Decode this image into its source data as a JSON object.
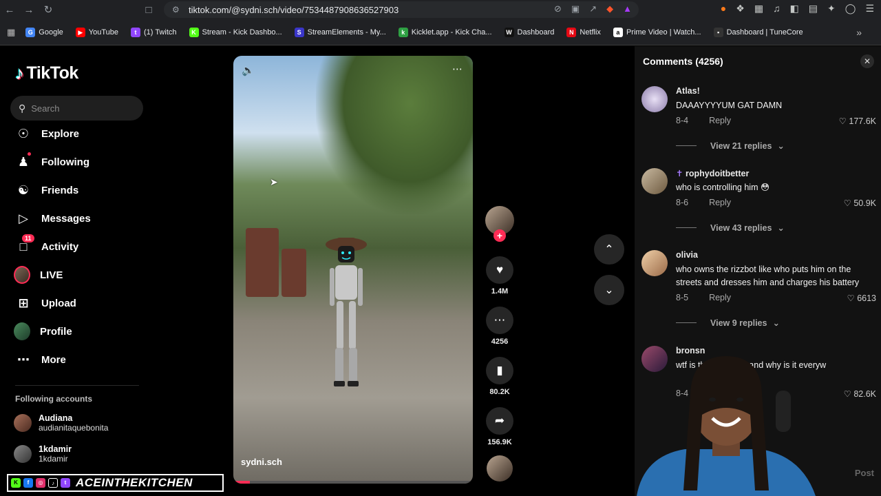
{
  "browser": {
    "url": "tiktok.com/@sydni.sch/video/7534487908636527903",
    "bookmarks": [
      {
        "label": "Google",
        "color": "#4285f4",
        "glyph": "G"
      },
      {
        "label": "YouTube",
        "color": "#ff0000",
        "glyph": "▶"
      },
      {
        "label": "(1) Twitch",
        "color": "#9146ff",
        "glyph": "t"
      },
      {
        "label": "Stream - Kick Dashbo...",
        "color": "#53fc18",
        "glyph": "K"
      },
      {
        "label": "StreamElements - My...",
        "color": "#3a36c9",
        "glyph": "S"
      },
      {
        "label": "Kicklet.app - Kick Cha...",
        "color": "#2ea043",
        "glyph": "k"
      },
      {
        "label": "Dashboard",
        "color": "#111111",
        "glyph": "W"
      },
      {
        "label": "Netflix",
        "color": "#e50914",
        "glyph": "N"
      },
      {
        "label": "Prime Video | Watch...",
        "color": "#ffffff",
        "glyph": "a"
      },
      {
        "label": "Dashboard | TuneCore",
        "color": "#333333",
        "glyph": "▪"
      }
    ]
  },
  "sidebar": {
    "logo": "TikTok",
    "search_placeholder": "Search",
    "items": [
      {
        "label": "Explore",
        "icon": "⊘"
      },
      {
        "label": "Following",
        "icon": "👤"
      },
      {
        "label": "Friends",
        "icon": "👥"
      },
      {
        "label": "Messages",
        "icon": "▽"
      },
      {
        "label": "Activity",
        "icon": "✉",
        "badge": "11"
      },
      {
        "label": "LIVE",
        "icon": "live"
      },
      {
        "label": "Upload",
        "icon": "⊞"
      },
      {
        "label": "Profile",
        "icon": "avatar"
      },
      {
        "label": "More",
        "icon": "···"
      }
    ],
    "following_header": "Following accounts",
    "following": [
      {
        "name": "Audiana",
        "handle": "audianitaquebonita"
      },
      {
        "name": "1kdamir",
        "handle": "1kdamir"
      }
    ]
  },
  "video": {
    "author": "sydni.sch",
    "progress_pct": 7,
    "likes": "1.4M",
    "comments": "4256",
    "saves": "80.2K",
    "shares": "156.9K"
  },
  "comments_panel": {
    "title": "Comments (4256)",
    "reply_label": "Reply",
    "post_label": "Post",
    "items": [
      {
        "user": "Atlas!",
        "text": "DAAAYYYYUM GAT DAMN",
        "date": "8-4",
        "likes": "177.6K",
        "replies": "View 21 replies"
      },
      {
        "user": "rophydoitbetter",
        "text": "who is controlling him 😳",
        "date": "8-6",
        "likes": "50.9K",
        "replies": "View 43 replies"
      },
      {
        "user": "olivia",
        "text": "who owns the rizzbot like who puts him on the streets and dresses him and charges his battery",
        "date": "8-5",
        "likes": "6613",
        "replies": "View 9 replies"
      },
      {
        "user": "bronsn",
        "text": "wtf is the this thing and why is it everyw",
        "date": "8-4",
        "likes": "82.6K"
      }
    ]
  },
  "stream_overlay": {
    "tag": "ACEINTHEKITCHEN"
  }
}
